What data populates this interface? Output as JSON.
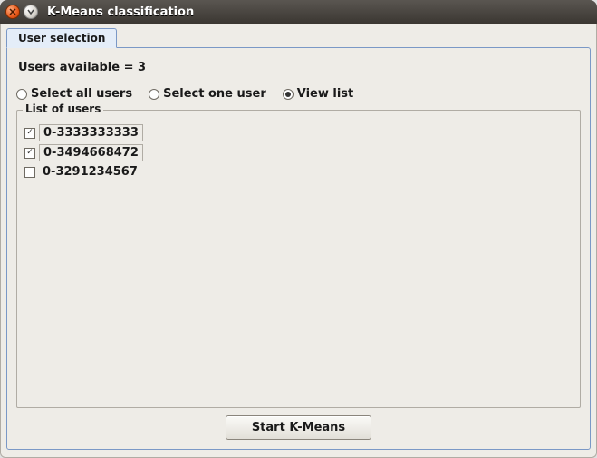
{
  "window": {
    "title": "K-Means classification"
  },
  "tab": {
    "label": "User selection"
  },
  "users_available_label": "Users available = 3",
  "radios": {
    "select_all": {
      "label": "Select all users",
      "checked": false
    },
    "select_one": {
      "label": "Select one user",
      "checked": false
    },
    "view_list": {
      "label": "View list",
      "checked": true
    }
  },
  "fieldset_legend": "List of users",
  "users": [
    {
      "checked": true,
      "label": "0-3333333333",
      "boxed": true
    },
    {
      "checked": true,
      "label": "0-3494668472",
      "boxed": true
    },
    {
      "checked": false,
      "label": "0-3291234567",
      "boxed": false
    }
  ],
  "start_button_label": "Start K-Means"
}
